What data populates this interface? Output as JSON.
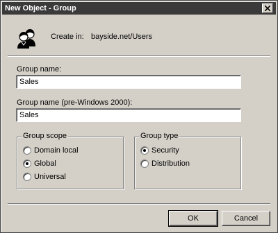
{
  "window": {
    "title": "New Object - Group"
  },
  "create_in": {
    "label": "Create in:",
    "path": "bayside.net/Users"
  },
  "group_name": {
    "label": "Group name:",
    "value": "Sales"
  },
  "group_name_pre2000": {
    "label": "Group name (pre-Windows 2000):",
    "value": "Sales"
  },
  "group_scope": {
    "legend": "Group scope",
    "options": [
      {
        "label": "Domain local",
        "checked": false
      },
      {
        "label": "Global",
        "checked": true
      },
      {
        "label": "Universal",
        "checked": false
      }
    ]
  },
  "group_type": {
    "legend": "Group type",
    "options": [
      {
        "label": "Security",
        "checked": true
      },
      {
        "label": "Distribution",
        "checked": false
      }
    ]
  },
  "buttons": {
    "ok": "OK",
    "cancel": "Cancel"
  },
  "icons": {
    "group_icon": "users-group-icon",
    "close_icon": "close-icon"
  }
}
